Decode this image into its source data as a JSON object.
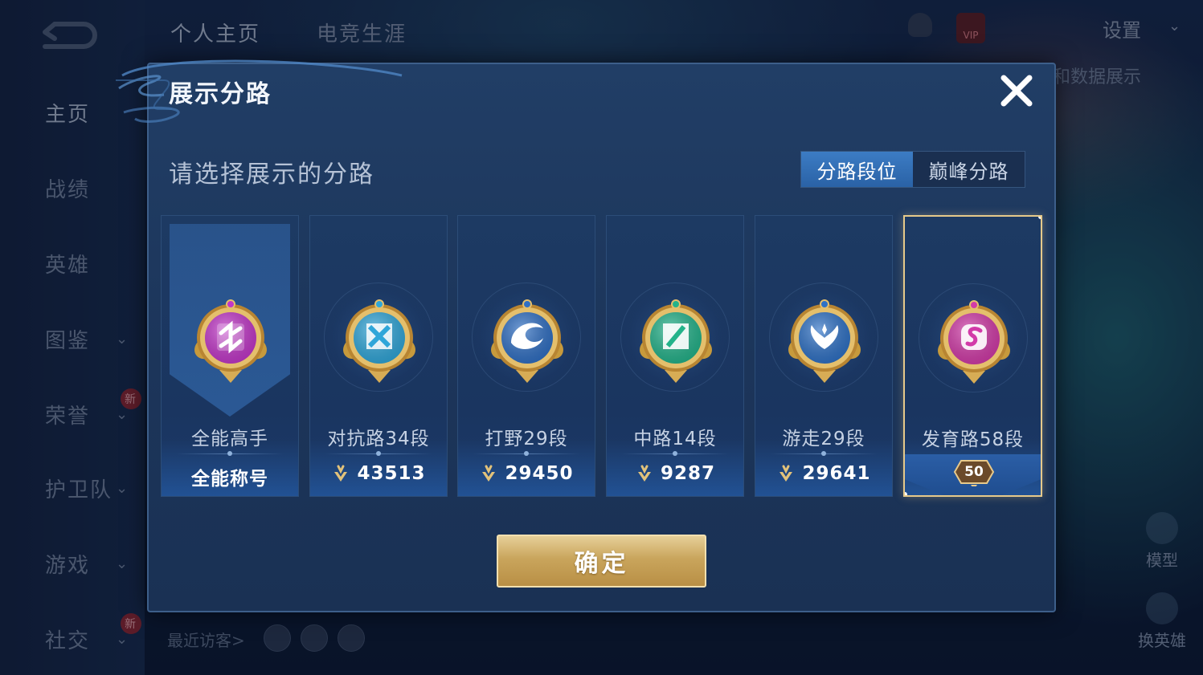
{
  "background": {
    "nav_items": [
      {
        "label": "主页",
        "has_chevron": false,
        "new": false,
        "active": true
      },
      {
        "label": "战绩",
        "has_chevron": false,
        "new": false,
        "active": false
      },
      {
        "label": "英雄",
        "has_chevron": false,
        "new": false,
        "active": false
      },
      {
        "label": "图鉴",
        "has_chevron": true,
        "new": false,
        "active": false
      },
      {
        "label": "荣誉",
        "has_chevron": true,
        "new": true,
        "active": false
      },
      {
        "label": "护卫队",
        "has_chevron": true,
        "new": false,
        "active": false
      },
      {
        "label": "游戏",
        "has_chevron": true,
        "new": false,
        "active": false
      },
      {
        "label": "社交",
        "has_chevron": true,
        "new": true,
        "active": false
      }
    ],
    "new_badge_text": "新",
    "top_tabs": [
      {
        "label": "个人主页",
        "active": true
      },
      {
        "label": "电竞生涯",
        "active": false
      }
    ],
    "settings_label": "设置",
    "vip_text": "VIP",
    "data_banner": "和数据展示",
    "recent_visitors": "最近访客>",
    "model_label": "模型",
    "switch_hero_label": "换英雄"
  },
  "modal": {
    "title": "展示分路",
    "prompt": "请选择展示的分路",
    "toggle": [
      {
        "label": "分路段位",
        "active": true
      },
      {
        "label": "巅峰分路",
        "active": false
      }
    ],
    "cards": [
      {
        "label": "全能高手",
        "value": "全能称号",
        "has_points_icon": false,
        "emblem": "allround",
        "color": "#c237c9",
        "selected": false
      },
      {
        "label": "对抗路34段",
        "value": "43513",
        "has_points_icon": true,
        "emblem": "clash",
        "color": "#2fa6d9",
        "selected": false
      },
      {
        "label": "打野29段",
        "value": "29450",
        "has_points_icon": true,
        "emblem": "jungle",
        "color": "#2f6fc4",
        "selected": false
      },
      {
        "label": "中路14段",
        "value": "9287",
        "has_points_icon": true,
        "emblem": "mid",
        "color": "#23b38a",
        "selected": false
      },
      {
        "label": "游走29段",
        "value": "29641",
        "has_points_icon": true,
        "emblem": "roam",
        "color": "#2e71c6",
        "selected": false
      },
      {
        "label": "发育路58段",
        "value": "50",
        "has_points_icon": false,
        "emblem": "farm",
        "color": "#d23aa8",
        "selected": true
      }
    ],
    "confirm_label": "确定",
    "accent_gold": "#e6c98a"
  }
}
